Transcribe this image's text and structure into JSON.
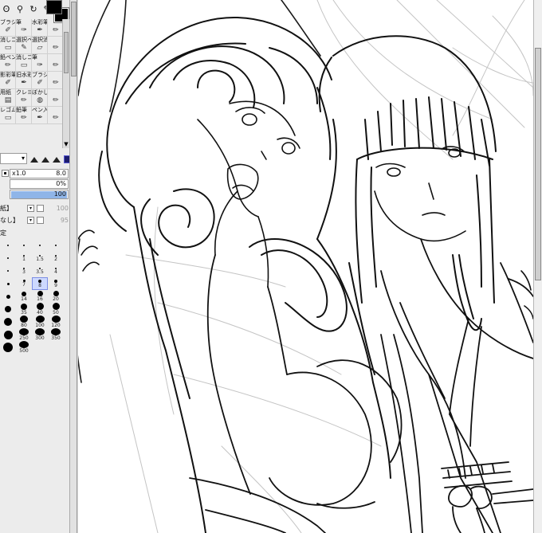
{
  "toolbar": {
    "tools": [
      {
        "icon": "lasso-icon",
        "glyph": "ʘ"
      },
      {
        "icon": "zoom-icon",
        "glyph": "⚲"
      },
      {
        "icon": "rotate-icon",
        "glyph": "↻"
      },
      {
        "icon": "eyedropper-icon",
        "glyph": "✎"
      }
    ],
    "main_color": "#000000",
    "sub_color": "#000000"
  },
  "brush_tools": [
    {
      "label": "ブラシ",
      "icon": "brush-icon",
      "glyph": "✐"
    },
    {
      "label": "筆",
      "icon": "pen-nib-icon",
      "glyph": "✑"
    },
    {
      "label": "水彩筆",
      "icon": "watercolor-icon",
      "glyph": "✒"
    },
    {
      "label": "",
      "icon": "tool-icon",
      "glyph": "✏"
    },
    {
      "label": "消しゴム",
      "icon": "eraser-icon",
      "glyph": "▭"
    },
    {
      "label": "選択ペン",
      "icon": "select-pen-icon",
      "glyph": "✎"
    },
    {
      "label": "選択消",
      "icon": "select-erase-icon",
      "glyph": "▱"
    },
    {
      "label": "",
      "icon": "tool-icon",
      "glyph": "✏"
    },
    {
      "label": "鉛ペン",
      "icon": "pencil-pen-icon",
      "glyph": "✏"
    },
    {
      "label": "消しゴム",
      "icon": "eraser-icon",
      "glyph": "▭"
    },
    {
      "label": "筆",
      "icon": "pen-nib-icon",
      "glyph": "✑"
    },
    {
      "label": "",
      "icon": "tool-icon",
      "glyph": "✏"
    },
    {
      "label": "影彩筆",
      "icon": "shade-brush-icon",
      "glyph": "✐"
    },
    {
      "label": "旧水彩",
      "icon": "old-watercolor-icon",
      "glyph": "✒"
    },
    {
      "label": "ブラシ浦",
      "icon": "brush-icon",
      "glyph": "✐"
    },
    {
      "label": "",
      "icon": "tool-icon",
      "glyph": "✏"
    },
    {
      "label": "用紙",
      "icon": "paper-icon",
      "glyph": "▤"
    },
    {
      "label": "クレヨン",
      "icon": "crayon-icon",
      "glyph": "✏"
    },
    {
      "label": "ぼかし",
      "icon": "blur-icon",
      "glyph": "◍"
    },
    {
      "label": "",
      "icon": "tool-icon",
      "glyph": "✏"
    },
    {
      "label": "レゴム",
      "icon": "eraser-icon",
      "glyph": "▭"
    },
    {
      "label": "鉛筆",
      "icon": "pencil-icon",
      "glyph": "✏"
    },
    {
      "label": "ペン入れ",
      "icon": "inking-pen-icon",
      "glyph": "✒"
    },
    {
      "label": "",
      "icon": "tool-icon",
      "glyph": "✏"
    }
  ],
  "brush_settings": {
    "scale_label": "x1.0",
    "size_value": "8.0",
    "min_size": "0%",
    "density": "100",
    "texture_select": "紙】",
    "texture_value": "100",
    "blend_select": "なし】",
    "blend_value": "95",
    "advanced_label": "定"
  },
  "size_presets": [
    {
      "label": "",
      "size": 1
    },
    {
      "label": "",
      "size": 1
    },
    {
      "label": "",
      "size": 1
    },
    {
      "label": "",
      "size": 1
    },
    {
      "label": "",
      "size": 1
    },
    {
      "label": "1",
      "size": 1
    },
    {
      "label": "1.5",
      "size": 1
    },
    {
      "label": "2",
      "size": 1
    },
    {
      "label": "",
      "size": 2
    },
    {
      "label": "3",
      "size": 2
    },
    {
      "label": "3.5",
      "size": 2
    },
    {
      "label": "4",
      "size": 2
    },
    {
      "label": "",
      "size": 3
    },
    {
      "label": "7",
      "size": 3
    },
    {
      "label": "8",
      "size": 4,
      "selected": true
    },
    {
      "label": "9",
      "size": 4
    },
    {
      "label": "",
      "size": 5
    },
    {
      "label": "14",
      "size": 6
    },
    {
      "label": "16",
      "size": 7
    },
    {
      "label": "20",
      "size": 7
    },
    {
      "label": "",
      "size": 8
    },
    {
      "label": "35",
      "size": 8
    },
    {
      "label": "40",
      "size": 9
    },
    {
      "label": "50",
      "size": 9
    },
    {
      "label": "",
      "size": 10
    },
    {
      "label": "80",
      "size": 10
    },
    {
      "label": "100",
      "size": 11
    },
    {
      "label": "120",
      "size": 11
    },
    {
      "label": "",
      "size": 11
    },
    {
      "label": "250",
      "size": 12
    },
    {
      "label": "300",
      "size": 12
    },
    {
      "label": "350",
      "size": 12
    },
    {
      "label": "",
      "size": 12
    },
    {
      "label": "500",
      "size": 12
    }
  ]
}
